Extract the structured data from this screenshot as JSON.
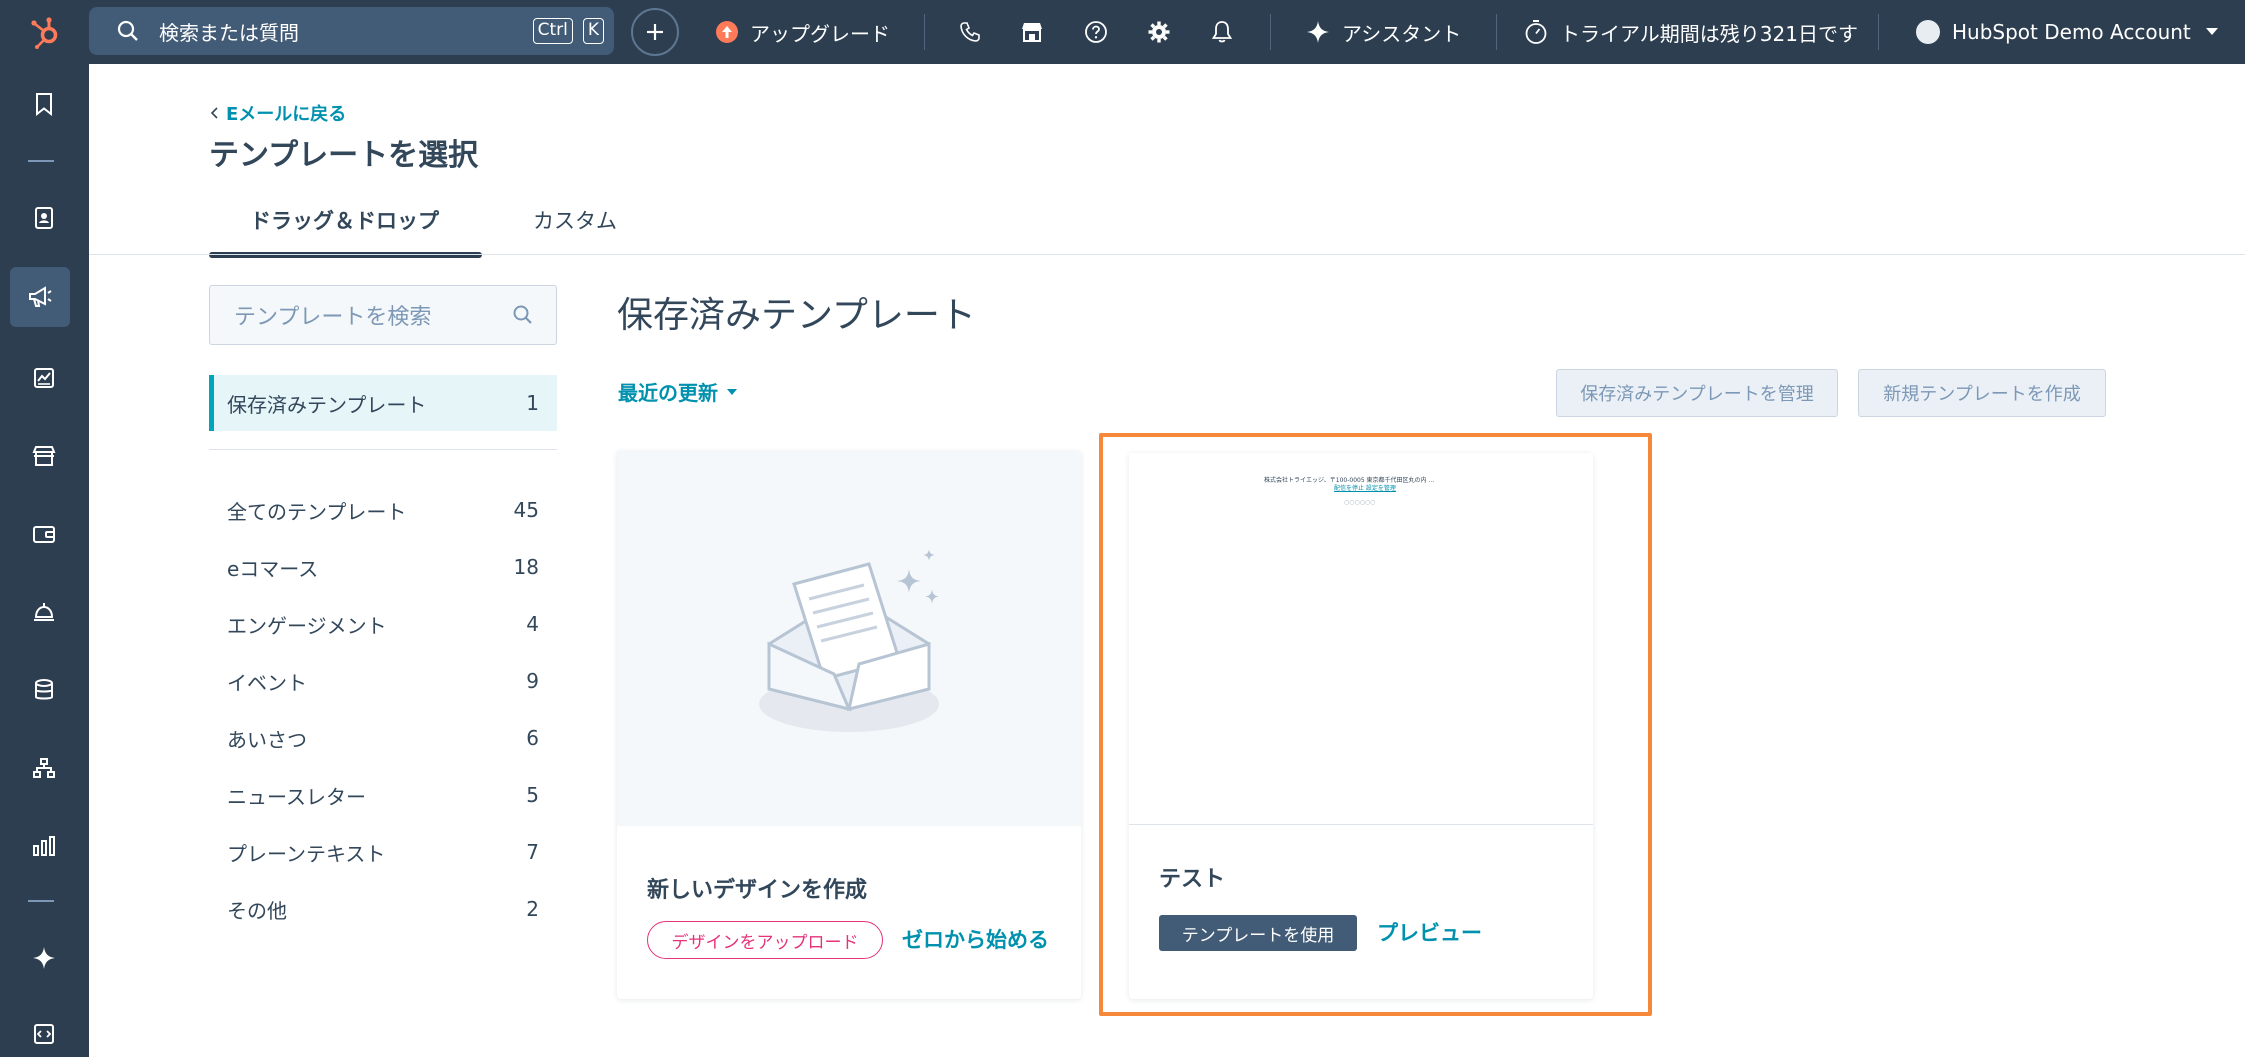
{
  "topnav": {
    "search_placeholder": "検索または質問",
    "shortcut_ctrl": "Ctrl",
    "shortcut_key": "K",
    "upgrade_label": "アップグレード",
    "assistant_label": "アシスタント",
    "trial_label": "トライアル期間は残り321日です",
    "account_name": "HubSpot Demo Account",
    "brand_color": "#ff7a59"
  },
  "header": {
    "back_link": "Eメールに戻る",
    "title": "テンプレートを選択"
  },
  "tabs": [
    {
      "label": "ドラッグ＆ドロップ"
    },
    {
      "label": "カスタム"
    }
  ],
  "sidebar": {
    "search_placeholder": "テンプレートを検索",
    "saved": {
      "label": "保存済みテンプレート",
      "count": "1"
    },
    "categories": [
      {
        "label": "全てのテンプレート",
        "count": "45"
      },
      {
        "label": "eコマース",
        "count": "18"
      },
      {
        "label": "エンゲージメント",
        "count": "4"
      },
      {
        "label": "イベント",
        "count": "9"
      },
      {
        "label": "あいさつ",
        "count": "6"
      },
      {
        "label": "ニュースレター",
        "count": "5"
      },
      {
        "label": "プレーンテキスト",
        "count": "7"
      },
      {
        "label": "その他",
        "count": "2"
      }
    ]
  },
  "main": {
    "section_title": "保存済みテンプレート",
    "sort_label": "最近の更新",
    "manage_button": "保存済みテンプレートを管理",
    "create_button": "新規テンプレートを作成",
    "new_design_card": {
      "title": "新しいデザインを作成",
      "upload_button": "デザインをアップロード",
      "scratch_link": "ゼロから始める"
    },
    "template_card": {
      "title": "テスト",
      "use_button": "テンプレートを使用",
      "preview_link": "プレビュー",
      "thumb_line1": "株式会社トライエッジ、〒100-0005 東京都千代田区丸の内 ...",
      "thumb_line2": "配信を停止 設定を管理",
      "thumb_line3": "○○○○○○"
    },
    "highlight_color": "#f5883a"
  }
}
